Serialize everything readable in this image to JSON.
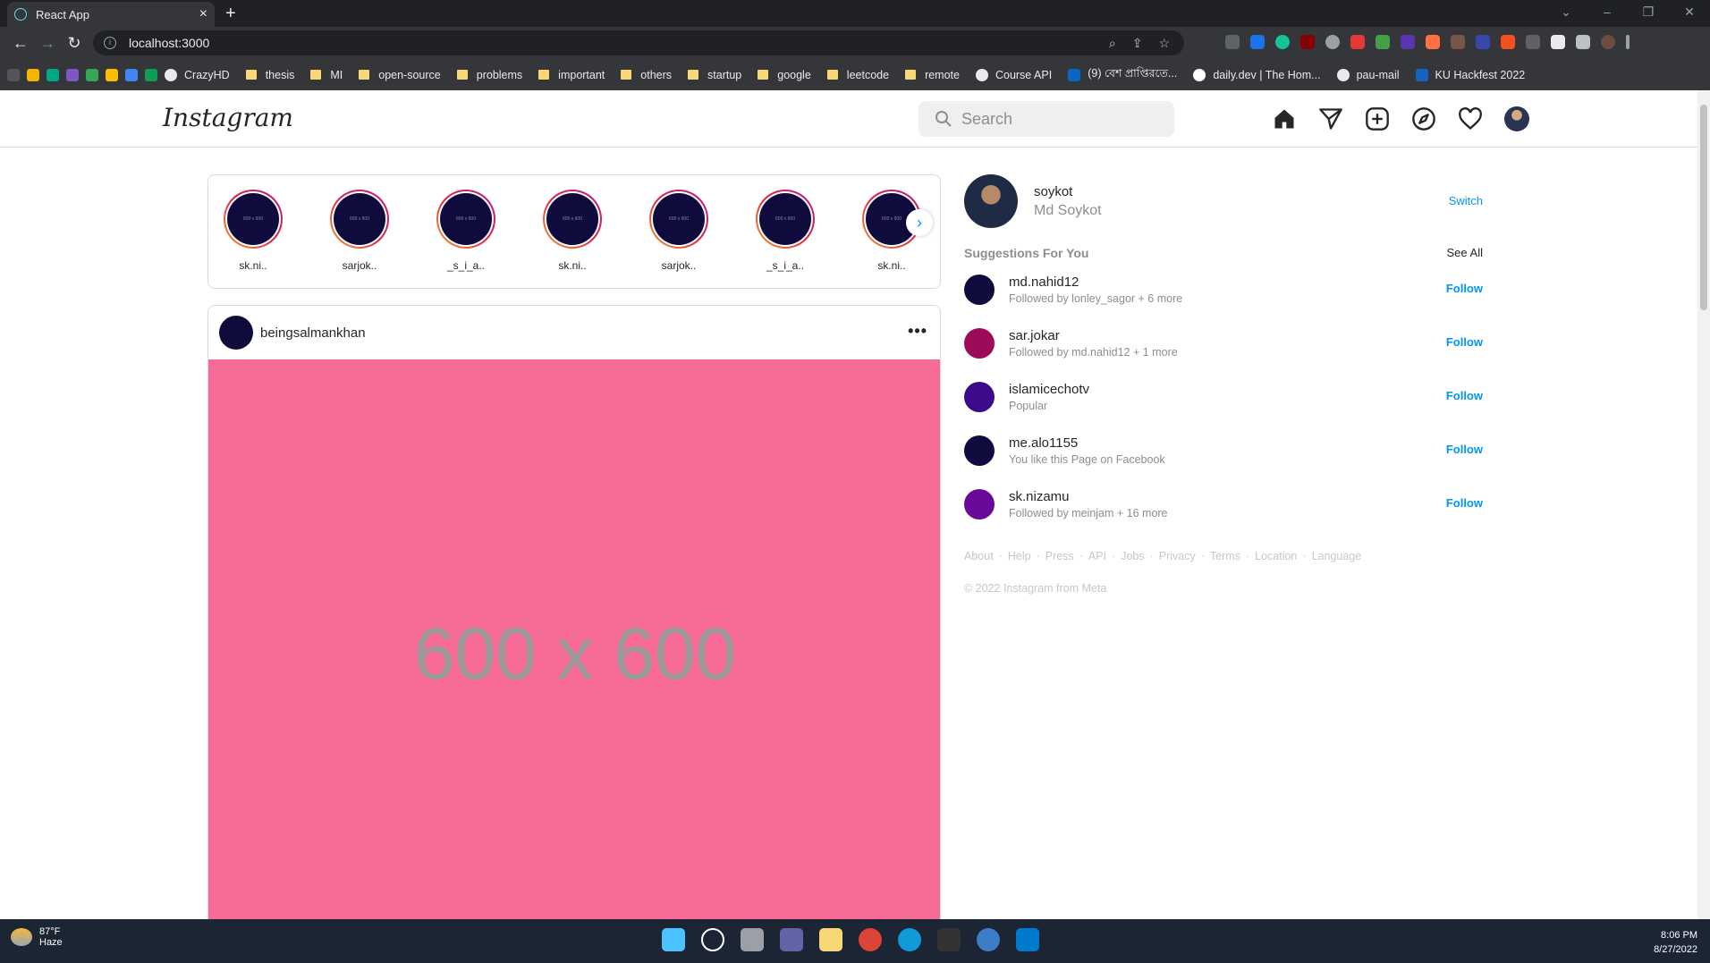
{
  "browser": {
    "tab_title": "React App",
    "url": "localhost:3000",
    "bookmarks": [
      "CrazyHD",
      "thesis",
      "MI",
      "open-source",
      "problems",
      "important",
      "others",
      "startup",
      "google",
      "leetcode",
      "remote",
      "Course API",
      "(9) বেশ প্রাপ্তিরতে...",
      "daily.dev | The Hom...",
      "pau-mail",
      "KU Hackfest 2022"
    ]
  },
  "ig": {
    "logo": "Instagram",
    "search_placeholder": "Search",
    "stories": [
      {
        "name": "sk.ni..",
        "img": "600 x 600"
      },
      {
        "name": "sarjok..",
        "img": "600 x 600"
      },
      {
        "name": "_s_i_a..",
        "img": "600 x 600"
      },
      {
        "name": "sk.ni..",
        "img": "600 x 600"
      },
      {
        "name": "sarjok..",
        "img": "600 x 600"
      },
      {
        "name": "_s_i_a..",
        "img": "600 x 600"
      },
      {
        "name": "sk.ni..",
        "img": "600 x 600"
      }
    ],
    "post": {
      "user": "beingsalmankhan",
      "more": "•••",
      "image_text": "600 x 600",
      "image_color": "#f66c96"
    },
    "me": {
      "username": "soykot",
      "fullname": "Md Soykot",
      "switch": "Switch"
    },
    "suggestions_title": "Suggestions For You",
    "see_all": "See All",
    "suggestions": [
      {
        "user": "md.nahid12",
        "sub": "Followed by lonley_sagor + 6 more",
        "follow": "Follow",
        "color": "#0f0c3d"
      },
      {
        "user": "sar.jokar",
        "sub": "Followed by md.nahid12 + 1 more",
        "follow": "Follow",
        "color": "#9c0a5a"
      },
      {
        "user": "islamicechotv",
        "sub": "Popular",
        "follow": "Follow",
        "color": "#3c0a8a"
      },
      {
        "user": "me.alo1155",
        "sub": "You like this Page on Facebook",
        "follow": "Follow",
        "color": "#0f0c3d"
      },
      {
        "user": "sk.nizamu",
        "sub": "Followed by meinjam + 16 more",
        "follow": "Follow",
        "color": "#6a0a9a"
      }
    ],
    "footer_links": [
      "About",
      "Help",
      "Press",
      "API",
      "Jobs",
      "Privacy",
      "Terms",
      "Location",
      "Language"
    ],
    "copyright": "© 2022 Instagram from Meta"
  },
  "taskbar": {
    "temp": "87°F",
    "weather": "Haze",
    "time": "8:06 PM",
    "date": "8/27/2022"
  }
}
